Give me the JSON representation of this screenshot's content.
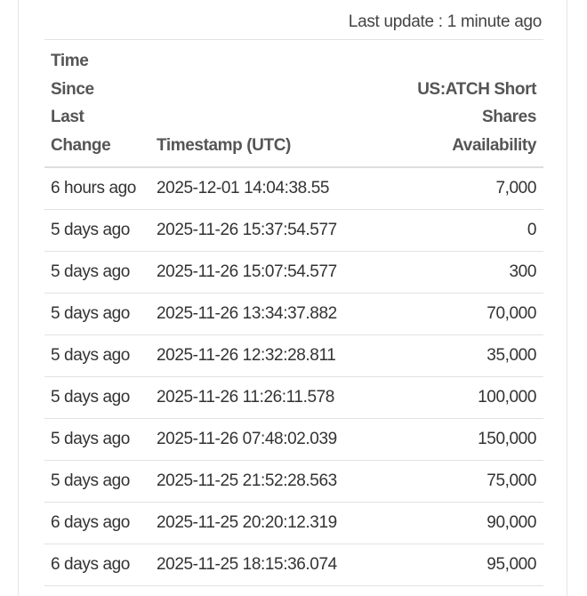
{
  "last_update": "Last update : 1 minute ago",
  "table": {
    "headers": {
      "since": [
        "Time",
        "Since",
        "Last",
        "Change"
      ],
      "timestamp": "Timestamp (UTC)",
      "shares": [
        "US:ATCH Short Shares",
        "Availability"
      ]
    },
    "rows": [
      {
        "since": "6 hours ago",
        "timestamp": "2025-12-01 14:04:38.55",
        "shares": "7,000"
      },
      {
        "since": "5 days ago",
        "timestamp": "2025-11-26 15:37:54.577",
        "shares": "0"
      },
      {
        "since": "5 days ago",
        "timestamp": "2025-11-26 15:07:54.577",
        "shares": "300"
      },
      {
        "since": "5 days ago",
        "timestamp": "2025-11-26 13:34:37.882",
        "shares": "70,000"
      },
      {
        "since": "5 days ago",
        "timestamp": "2025-11-26 12:32:28.811",
        "shares": "35,000"
      },
      {
        "since": "5 days ago",
        "timestamp": "2025-11-26 11:26:11.578",
        "shares": "100,000"
      },
      {
        "since": "5 days ago",
        "timestamp": "2025-11-26 07:48:02.039",
        "shares": "150,000"
      },
      {
        "since": "5 days ago",
        "timestamp": "2025-11-25 21:52:28.563",
        "shares": "75,000"
      },
      {
        "since": "6 days ago",
        "timestamp": "2025-11-25 20:20:12.319",
        "shares": "90,000"
      },
      {
        "since": "6 days ago",
        "timestamp": "2025-11-25 18:15:36.074",
        "shares": "95,000"
      }
    ]
  }
}
